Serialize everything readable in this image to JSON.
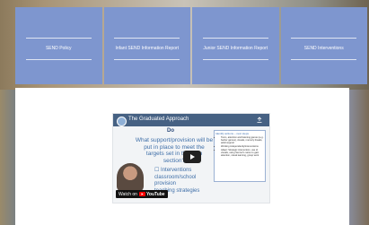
{
  "nav": {
    "items": [
      {
        "label": "SEND Policy"
      },
      {
        "label": "Infant SEND Information Report"
      },
      {
        "label": "Junior SEND Information Report"
      },
      {
        "label": "SEND Interventions"
      }
    ]
  },
  "video": {
    "title": "The Graduated Approach",
    "heading": "Do",
    "question": "What support/provision will be put in place to meet the targets set in the plan section?",
    "bullets": [
      "Interventions",
      "classroom/school provision",
      "teaching strategies"
    ],
    "watch_on": "Watch on",
    "platform": "YouTube",
    "panel_heading": "Identify actions – next steps",
    "panel_items": [
      "Toom, attention and listening games (e.g. barrier games), visuals, memory breaks, adult support",
      "Working independently/interventions",
      "Adapt: Strategic intervention, use of visuals, using Senner's name to gain attention, visual learning, group work"
    ]
  },
  "colors": {
    "nav_tile": "#7e96cf",
    "play_button": "#212121",
    "youtube_red": "#ff0000"
  }
}
